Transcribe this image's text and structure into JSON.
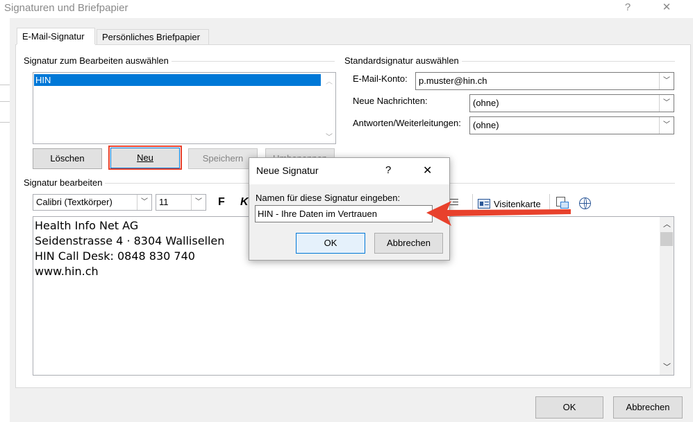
{
  "window": {
    "title": "Signaturen und Briefpapier",
    "help": "?",
    "close": "✕"
  },
  "tabs": [
    "E-Mail-Signatur",
    "Persönliches Briefpapier"
  ],
  "select_group": {
    "label": "Signatur zum Bearbeiten auswählen",
    "items": [
      "HIN"
    ]
  },
  "buttons": {
    "delete": "Löschen",
    "new": "Neu",
    "save": "Speichern",
    "rename": "Umbenennen"
  },
  "default_group": {
    "label": "Standardsignatur auswählen",
    "account_label": "E-Mail-Konto:",
    "account_value": "p.muster@hin.ch",
    "new_msg_label": "Neue Nachrichten:",
    "new_msg_value": "(ohne)",
    "reply_label": "Antworten/Weiterleitungen:",
    "reply_value": "(ohne)"
  },
  "edit_group": {
    "label": "Signatur bearbeiten",
    "font": "Calibri (Textkörper)",
    "size": "11",
    "bold": "F",
    "italic": "K",
    "business_card": "Visitenkarte",
    "lines": [
      "Health Info Net AG",
      "Seidenstrasse 4 · 8304 Wallisellen",
      "HIN Call Desk: 0848 830 740",
      "www.hin.ch"
    ]
  },
  "footer": {
    "ok": "OK",
    "cancel": "Abbrechen"
  },
  "dialog": {
    "title": "Neue Signatur",
    "help": "?",
    "close": "✕",
    "prompt": "Namen für diese Signatur eingeben:",
    "input_value": "HIN - Ihre Daten im Vertrauen",
    "ok": "OK",
    "cancel": "Abbrechen"
  },
  "colors": {
    "highlight": "#0078d7",
    "annotation_red": "#e8412c",
    "focus_border": "#e8412c"
  }
}
